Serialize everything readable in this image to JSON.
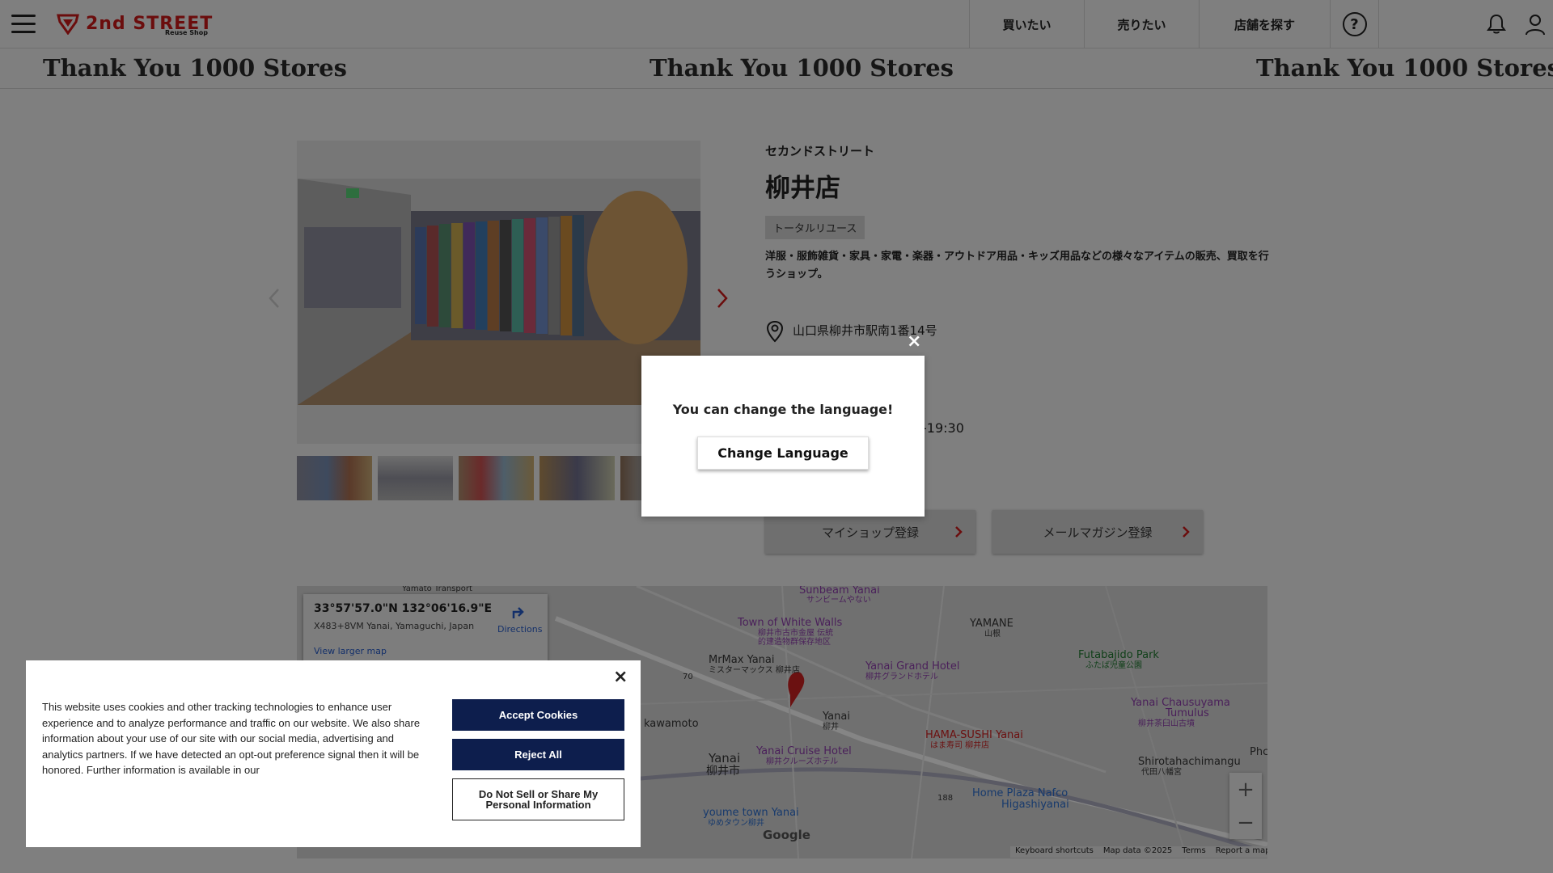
{
  "header": {
    "logo_text": "2nd STREET",
    "logo_sub": "Reuse Shop",
    "nav": [
      "買いたい",
      "売りたい",
      "店舗を探す"
    ],
    "help_label": "?"
  },
  "banner": {
    "text": "Thank You 1000 Stores"
  },
  "store": {
    "kana": "セカンドストリート",
    "name": "柳井店",
    "tag": "トータルリユース",
    "description": "洋服・服飾雑貨・家具・家電・楽器・アウトドア用品・キッズ用品などの様々なアイテムの販売、買取を行うショップ。",
    "address": "山口県柳井市駅南1番14号",
    "hours": "-19:30",
    "myshop_button": "マイショップ登録",
    "mail_button": "メールマガジン登録"
  },
  "map": {
    "coord": "33°57'57.0\"N 132°06'16.9\"E",
    "plus_code": "X483+8VM Yanai, Yamaguchi, Japan",
    "directions": "Directions",
    "larger_map": "View larger map",
    "google": "Google",
    "footer": [
      "Keyboard shortcuts",
      "Map data ©2025",
      "Terms",
      "Report a map error"
    ],
    "zoom_in": "+",
    "zoom_out": "−",
    "labels": {
      "yamato": "Yamato Transport",
      "sunbeam": "Sunbeam Yanai",
      "sunbeam_jp": "サンビームやない",
      "town_walls": "Town of White Walls",
      "town_walls_jp1": "柳井市古市金屋 伝統",
      "town_walls_jp2": "的建造物群保存地区",
      "yamane": "YAMANE",
      "yamane_jp": "山根",
      "futabajido": "Futabajido Park",
      "futabajido_jp": "ふたば児童公園",
      "mrmax": "MrMax Yanai",
      "mrmax_jp": "ミスターマックス 柳井店",
      "grand_hotel": "Yanai Grand Hotel",
      "grand_hotel_jp": "柳井グランドホテル",
      "chausuyama1": "Yanai Chausuyama",
      "chausuyama2": "Tumulus",
      "chausuyama_jp": "柳井茶臼山古墳",
      "yanai_station": "Yanai",
      "yanai_station_jp": "柳井",
      "hama_sushi": "HAMA-SUSHI Yanai",
      "hama_sushi_jp": "はま寿司 柳井店",
      "kawamoto": "kawamoto",
      "yanai_city": "Yanai",
      "yanai_city_jp": "柳井市",
      "cruise_hotel": "Yanai Cruise Hotel",
      "cruise_hotel_jp": "柳井クルーズホテル",
      "shirotahachimangu": "Shirotahachimangu",
      "shirotahachimangu_jp": "代田八幡宮",
      "home_plaza": "Home Plaza Nafco",
      "higashiyanai": "Higashiyanai",
      "youme": "youme town Yanai",
      "youme_jp": "ゆめタウン柳井",
      "road_188": "188",
      "road_70": "70",
      "phc": "Phc"
    }
  },
  "language_modal": {
    "close": "×",
    "message": "You can change the language!",
    "button": "Change Language"
  },
  "cookie_banner": {
    "close": "×",
    "text": "This website uses cookies and other tracking technologies to enhance user experience and to analyze performance and traffic on our website. We also share information about your use of our site with our social media, advertising and analytics partners. If we have detected an opt-out preference signal then it will be honored. Further information is available in our",
    "accept": "Accept Cookies",
    "reject": "Reject All",
    "do_not_sell": "Do Not Sell or Share My Personal Information"
  },
  "colors": {
    "brand_red": "#a31b1b",
    "overlay_gray": "#7f7f7f",
    "cookie_button_navy": "#0d1e4d"
  }
}
